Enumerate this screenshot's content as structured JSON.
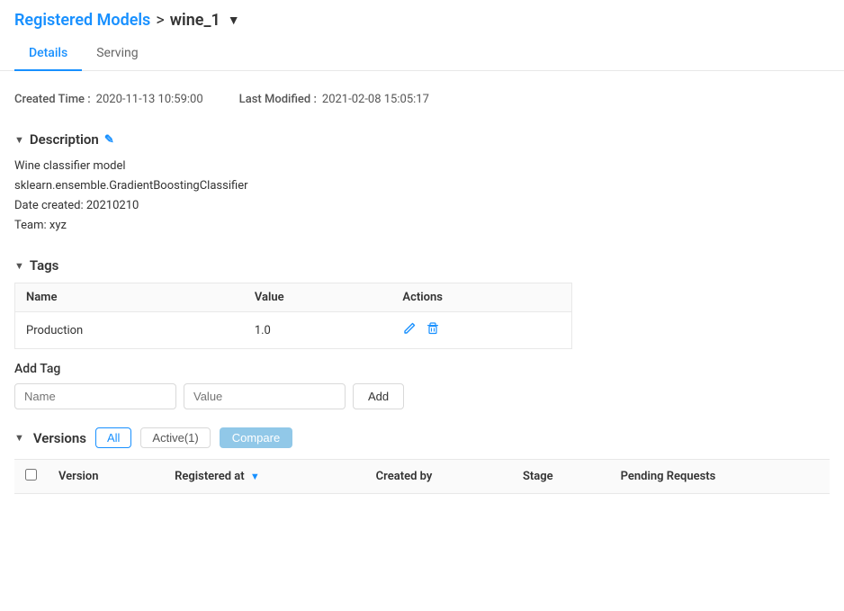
{
  "breadcrumb": {
    "parent_label": "Registered Models",
    "separator": ">",
    "current_label": "wine_1",
    "dropdown_icon": "▼"
  },
  "tabs": [
    {
      "label": "Details",
      "active": true
    },
    {
      "label": "Serving",
      "active": false
    }
  ],
  "meta": {
    "created_label": "Created Time :",
    "created_value": "2020-11-13 10:59:00",
    "modified_label": "Last Modified :",
    "modified_value": "2021-02-08 15:05:17"
  },
  "description_section": {
    "title": "Description",
    "edit_icon": "✎",
    "chevron": "▼",
    "lines": [
      "Wine classifier model",
      "sklearn.ensemble.GradientBoostingClassifier",
      "Date created: 20210210",
      "Team: xyz"
    ]
  },
  "tags_section": {
    "title": "Tags",
    "chevron": "▼",
    "columns": [
      "Name",
      "Value",
      "Actions"
    ],
    "rows": [
      {
        "name": "Production",
        "value": "1.0"
      }
    ],
    "edit_icon": "✎",
    "delete_icon": "🗑"
  },
  "add_tag": {
    "label": "Add Tag",
    "name_placeholder": "Name",
    "value_placeholder": "Value",
    "button_label": "Add"
  },
  "versions_section": {
    "title": "Versions",
    "chevron": "▼",
    "filter_all": "All",
    "filter_active": "Active(1)",
    "compare_btn": "Compare",
    "columns": [
      {
        "label": "",
        "key": "checkbox"
      },
      {
        "label": "Version",
        "key": "version"
      },
      {
        "label": "Registered at",
        "key": "registered_at",
        "sortable": true
      },
      {
        "label": "Created by",
        "key": "created_by"
      },
      {
        "label": "Stage",
        "key": "stage"
      },
      {
        "label": "Pending Requests",
        "key": "pending_requests"
      }
    ]
  }
}
